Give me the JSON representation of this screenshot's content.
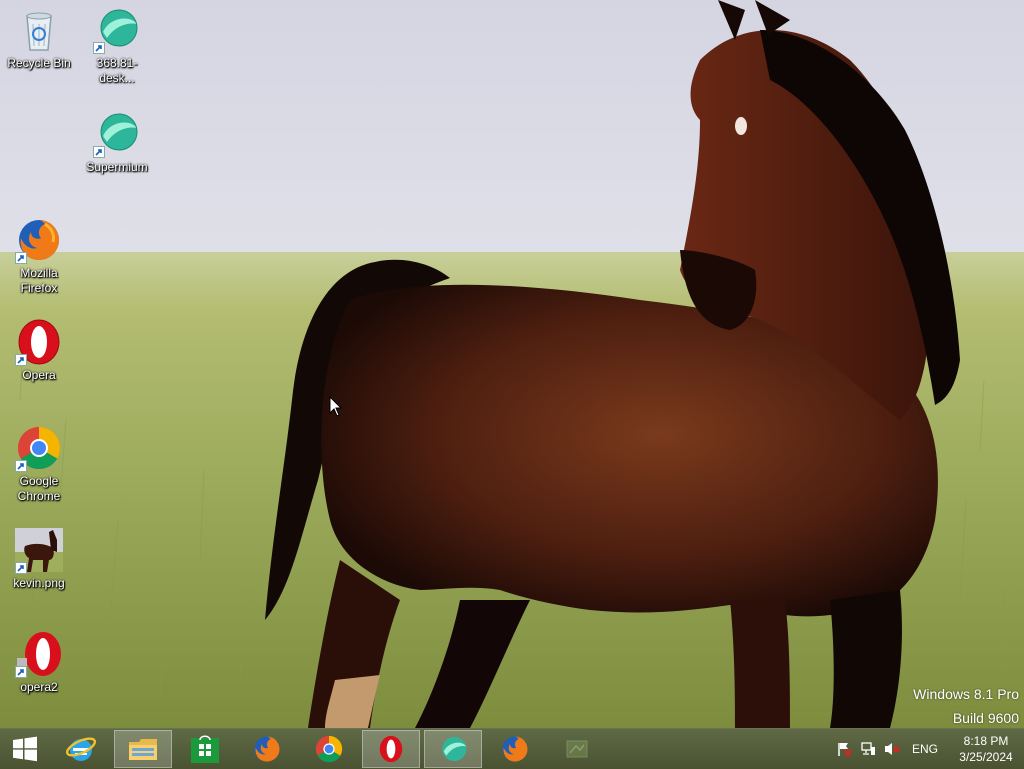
{
  "desktop": {
    "icons": [
      {
        "label": "Recycle Bin",
        "icon": "recycle-bin-icon"
      },
      {
        "label": "368.81-desk...",
        "icon": "supermium-icon"
      },
      {
        "label": "Supermium",
        "icon": "supermium-icon"
      },
      {
        "label": "Mozilla Firefox",
        "icon": "firefox-icon"
      },
      {
        "label": "Opera",
        "icon": "opera-icon"
      },
      {
        "label": "Google Chrome",
        "icon": "chrome-icon"
      },
      {
        "label": "kevin.png",
        "icon": "image-file-icon"
      },
      {
        "label": "opera2",
        "icon": "opera-icon"
      }
    ]
  },
  "watermark": {
    "line1": "Windows 8.1 Pro",
    "line2": "Build 9600"
  },
  "taskbar": {
    "buttons": [
      {
        "icon": "start-icon"
      },
      {
        "icon": "internet-explorer-icon"
      },
      {
        "icon": "file-explorer-icon",
        "active": true
      },
      {
        "icon": "store-icon"
      },
      {
        "icon": "firefox-icon"
      },
      {
        "icon": "chrome-icon"
      },
      {
        "icon": "opera-icon",
        "active": true
      },
      {
        "icon": "supermium-icon",
        "active": true
      },
      {
        "icon": "firefox-icon"
      },
      {
        "icon": "app-icon"
      }
    ],
    "tray": {
      "icons": [
        "action-center-flag-icon",
        "network-icon",
        "volume-muted-icon"
      ],
      "language": "ENG",
      "time": "8:18 PM",
      "date": "3/25/2024"
    }
  },
  "colors": {
    "sky": "#dadbe6",
    "grass": "#a9b86a",
    "horse": "#5a2412",
    "taskbar": "#555f3c"
  }
}
